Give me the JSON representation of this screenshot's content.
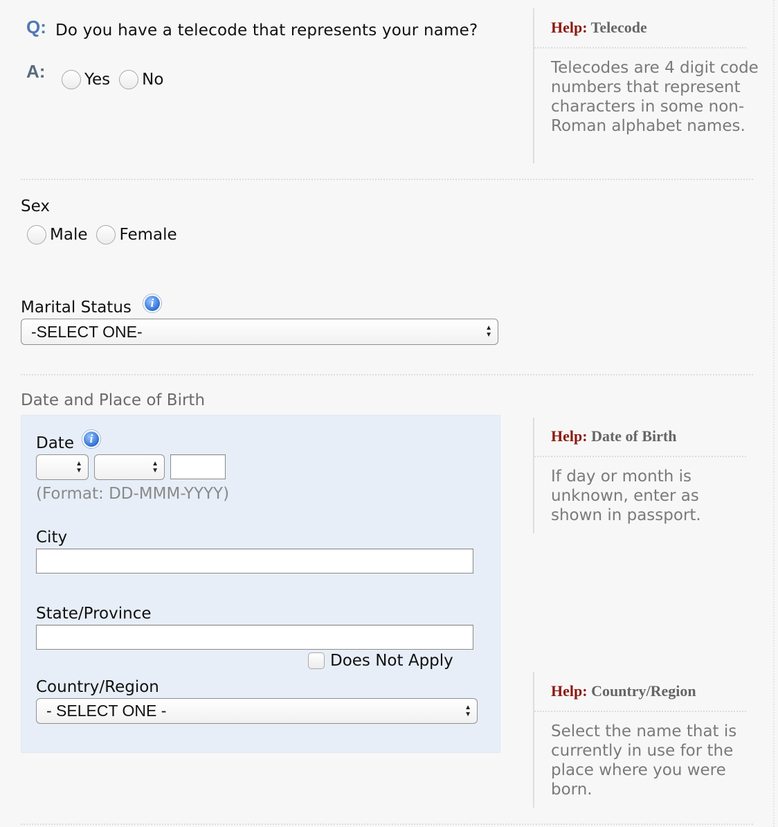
{
  "telecode": {
    "q_marker": "Q:",
    "a_marker": "A:",
    "question": "Do you have a telecode that represents your name?",
    "options": [
      "Yes",
      "No"
    ]
  },
  "help_telecode": {
    "prefix": "Help:",
    "title": "Telecode",
    "text": "Telecodes are 4 digit code numbers that represent characters in some non-Roman alphabet names."
  },
  "sex": {
    "label": "Sex",
    "options": [
      "Male",
      "Female"
    ]
  },
  "marital": {
    "label": "Marital Status",
    "info_icon": "info-icon",
    "selected": "-SELECT ONE-"
  },
  "birth": {
    "section_label": "Date and Place of Birth",
    "date_label": "Date",
    "format_hint": "(Format: DD-MMM-YYYY)",
    "day_selected": "",
    "month_selected": "",
    "year_value": "",
    "city_label": "City",
    "city_value": "",
    "state_label": "State/Province",
    "state_value": "",
    "does_not_apply": "Does Not Apply",
    "country_label": "Country/Region",
    "country_selected": "- SELECT ONE -"
  },
  "help_dob": {
    "prefix": "Help:",
    "title": "Date of Birth",
    "text": "If day or month is unknown, enter as shown in passport."
  },
  "help_country": {
    "prefix": "Help:",
    "title": "Country/Region",
    "text": "Select the name that is currently in use for the place where you were born."
  },
  "colors": {
    "help_red": "#8b1a12",
    "q_blue": "#4f78b5",
    "panel_blue": "#e7eef7",
    "background": "#f7f7f7"
  }
}
